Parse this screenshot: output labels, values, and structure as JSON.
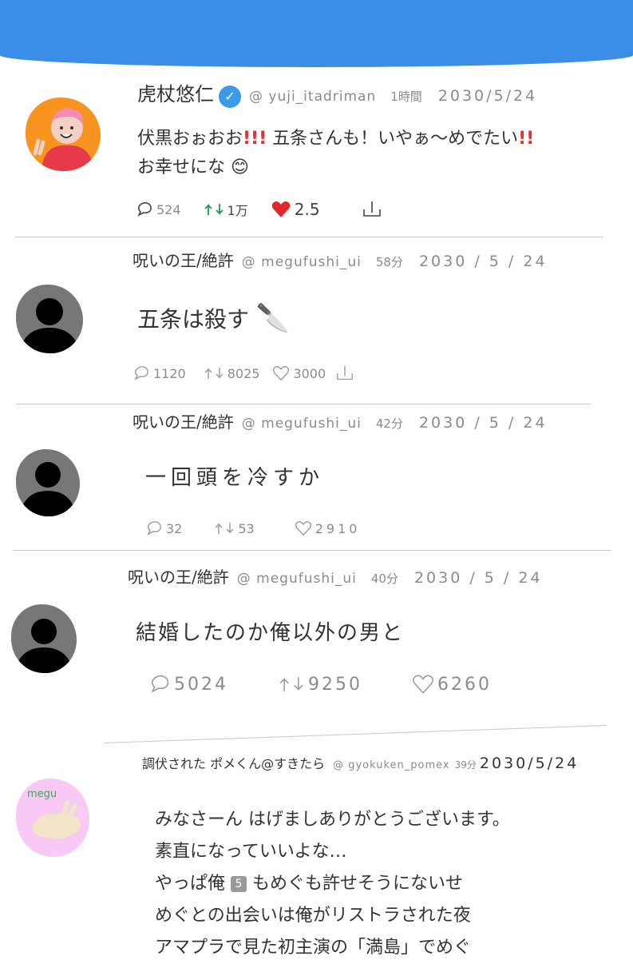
{
  "colors": {
    "accent": "#3a8ee8",
    "like_red": "#e02828",
    "retweet_green": "#1f9a52"
  },
  "tweets": [
    {
      "name": "虎杖悠仁",
      "handle": "@ yuji_itadriman",
      "time": "1時間",
      "date": "2030/5/24",
      "verified": true,
      "avatar_icon": "yuji-avatar-icon",
      "line1": "伏黒おぉおお",
      "line1_bang": "!!!",
      "line1b": "五条さんも！いやぁ〜めでたい",
      "line1_bang2": "!!",
      "line2": "お幸せにな 😊",
      "replies": "524",
      "retweets": "1万",
      "likes": "2.5"
    },
    {
      "name": "呪いの王/絶許",
      "handle": "@ megufushi_ui",
      "time": "58分",
      "date": "2030 / 5 / 24",
      "avatar_icon": "default-avatar-icon",
      "text": "五条は殺す",
      "knife": "🔪",
      "replies": "1120",
      "retweets": "8025",
      "likes": "3000"
    },
    {
      "name": "呪いの王/絶許",
      "handle": "@ megufushi_ui",
      "time": "42分",
      "date": "2030 / 5 / 24",
      "avatar_icon": "default-avatar-icon",
      "text": "一回頭を冷すか",
      "replies": "32",
      "retweets": "53",
      "likes": "2910"
    },
    {
      "name": "呪いの王/絶許",
      "handle": "@ megufushi_ui",
      "time": "40分",
      "date": "2030 / 5 / 24",
      "avatar_icon": "default-avatar-icon",
      "text": "結婚したのか俺以外の男と",
      "replies": "5024",
      "retweets": "9250",
      "likes": "6260"
    },
    {
      "name": "調伏された ポメくん@すきたら",
      "handle": "@ gyokuken_pomex",
      "time": "39分",
      "date": "2030/5/24",
      "avatar_icon": "megu-avatar-icon",
      "avatar_label": "megu",
      "lines": [
        "みなさーん はげましありがとうございます。",
        "素直になっていいよな…",
        "やっぱ俺",
        "もめぐも許せそうにないせ",
        "めぐとの出会いは俺がリストラされた夜",
        "アマプラで見た初主演の「満島」でめぐ"
      ],
      "badge": "5"
    }
  ]
}
